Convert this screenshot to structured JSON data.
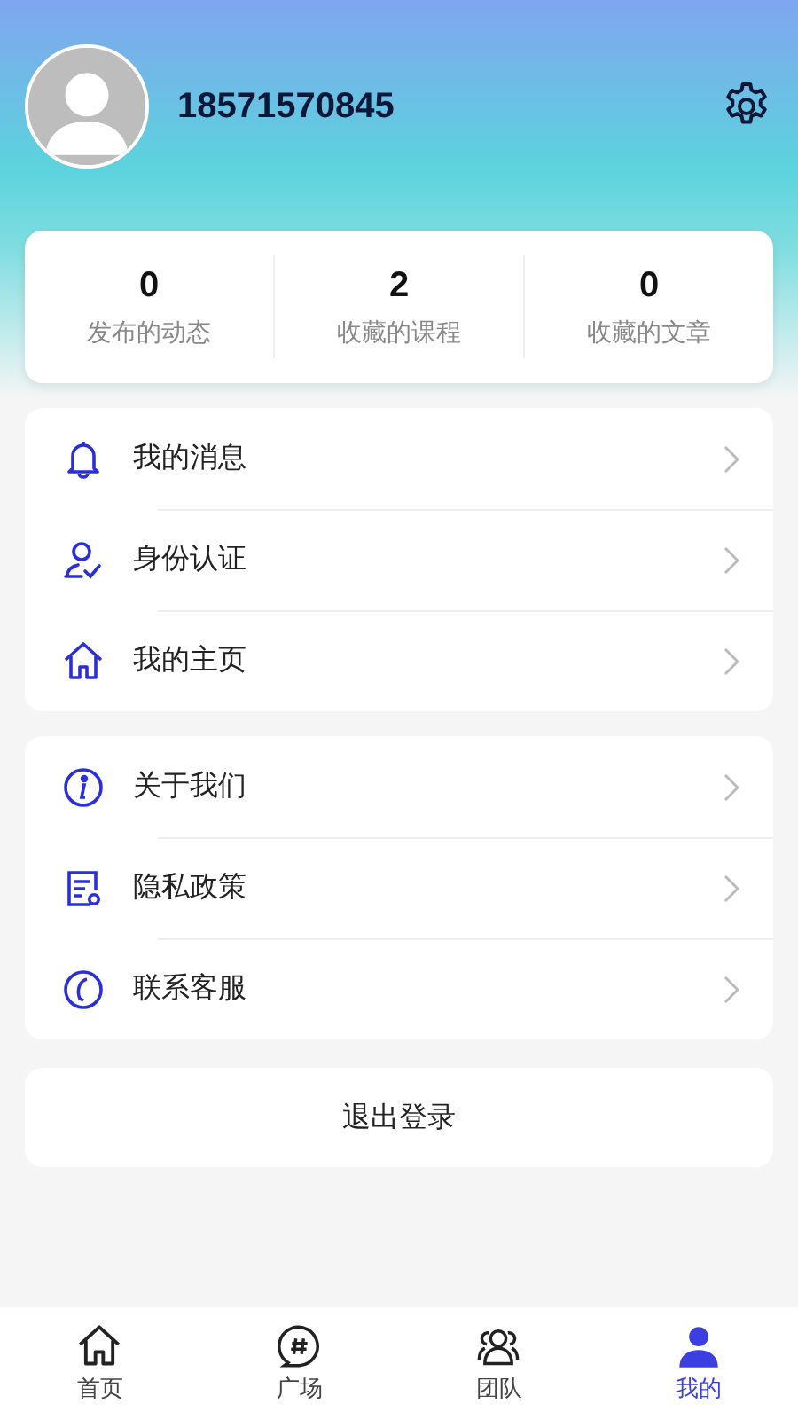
{
  "profile": {
    "phone": "18571570845"
  },
  "stats": [
    {
      "value": "0",
      "label": "发布的动态"
    },
    {
      "value": "2",
      "label": "收藏的课程"
    },
    {
      "value": "0",
      "label": "收藏的文章"
    }
  ],
  "menu_groups": [
    [
      {
        "kind": "bell",
        "label": "我的消息"
      },
      {
        "kind": "verify",
        "label": "身份认证"
      },
      {
        "kind": "home",
        "label": "我的主页"
      }
    ],
    [
      {
        "kind": "info",
        "label": "关于我们"
      },
      {
        "kind": "policy",
        "label": "隐私政策"
      },
      {
        "kind": "phone",
        "label": "联系客服"
      }
    ]
  ],
  "logout": "退出登录",
  "tabs": [
    {
      "kind": "home",
      "label": "首页",
      "selected": false
    },
    {
      "kind": "topic",
      "label": "广场",
      "selected": false
    },
    {
      "kind": "team",
      "label": "团队",
      "selected": false
    },
    {
      "kind": "me",
      "label": "我的",
      "selected": true
    }
  ]
}
